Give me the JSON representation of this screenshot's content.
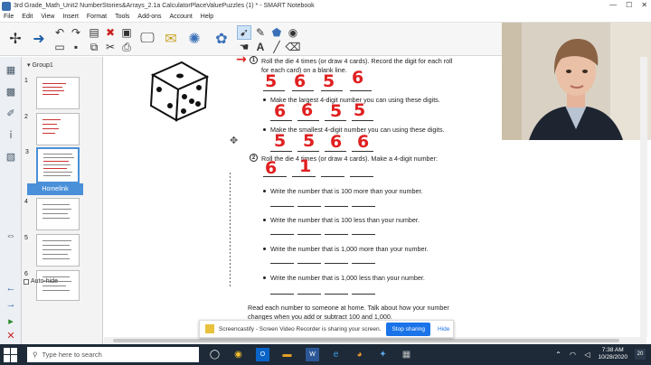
{
  "window": {
    "title": "3rd Grade_Math_Unit2 NumberStories&Arrays_2.1a CalculatorPlaceValuePuzzles (1) * - SMART Notebook",
    "controls": [
      "—",
      "☐",
      "✕"
    ]
  },
  "menu": [
    "File",
    "Edit",
    "View",
    "Insert",
    "Format",
    "Tools",
    "Add-ons",
    "Account",
    "Help"
  ],
  "panel": {
    "group_label": "Group1",
    "selected_thumb_label": "Homelink",
    "thumbs": [
      "1",
      "2",
      "3",
      "4",
      "5",
      "6"
    ],
    "autohide_label": "Auto-hide"
  },
  "worksheet": {
    "q1_number": "1",
    "q1_text_a": "Roll the die 4 times (or draw 4 cards). Record the digit for each roll",
    "q1_text_b": "for each card) on a blank line.",
    "q1_b1": "Make the largest 4-digit number you can using these digits.",
    "q1_b2": "Make the smallest 4-digit number you can using these digits.",
    "q2_number": "2",
    "q2_text": "Roll the die 4 times (or draw 4 cards). Make a 4-digit number:",
    "q2_b1": "Write the number that is 100 more than your number.",
    "q2_b2": "Write the number that is 100 less than your number.",
    "q2_b3": "Write the number that is 1,000 more than your number.",
    "q2_b4": "Write the number that is 1,000 less than your number.",
    "footer_a": "Read each number to someone at home. Talk about how your number",
    "footer_b": "changes when you add or subtract 100 and 1,000."
  },
  "handwriting": {
    "row1": [
      "5",
      "6",
      "5",
      "6"
    ],
    "row2": [
      "6",
      "6",
      "5",
      "5"
    ],
    "row3": [
      "5",
      "5",
      "6",
      "6"
    ],
    "row4": [
      "6",
      "1"
    ],
    "arrow": "→"
  },
  "screencastify": {
    "message": "Screencastify - Screen Video Recorder is sharing your screen.",
    "stop_label": "Stop sharing",
    "hide_label": "Hide"
  },
  "taskbar": {
    "search_placeholder": "Type here to search",
    "time": "7:38 AM",
    "date": "10/28/2020",
    "notification_count": "20"
  },
  "colors": {
    "handwriting": "#e02020",
    "selection": "#4a90d9",
    "taskbar": "#1e2a38"
  }
}
